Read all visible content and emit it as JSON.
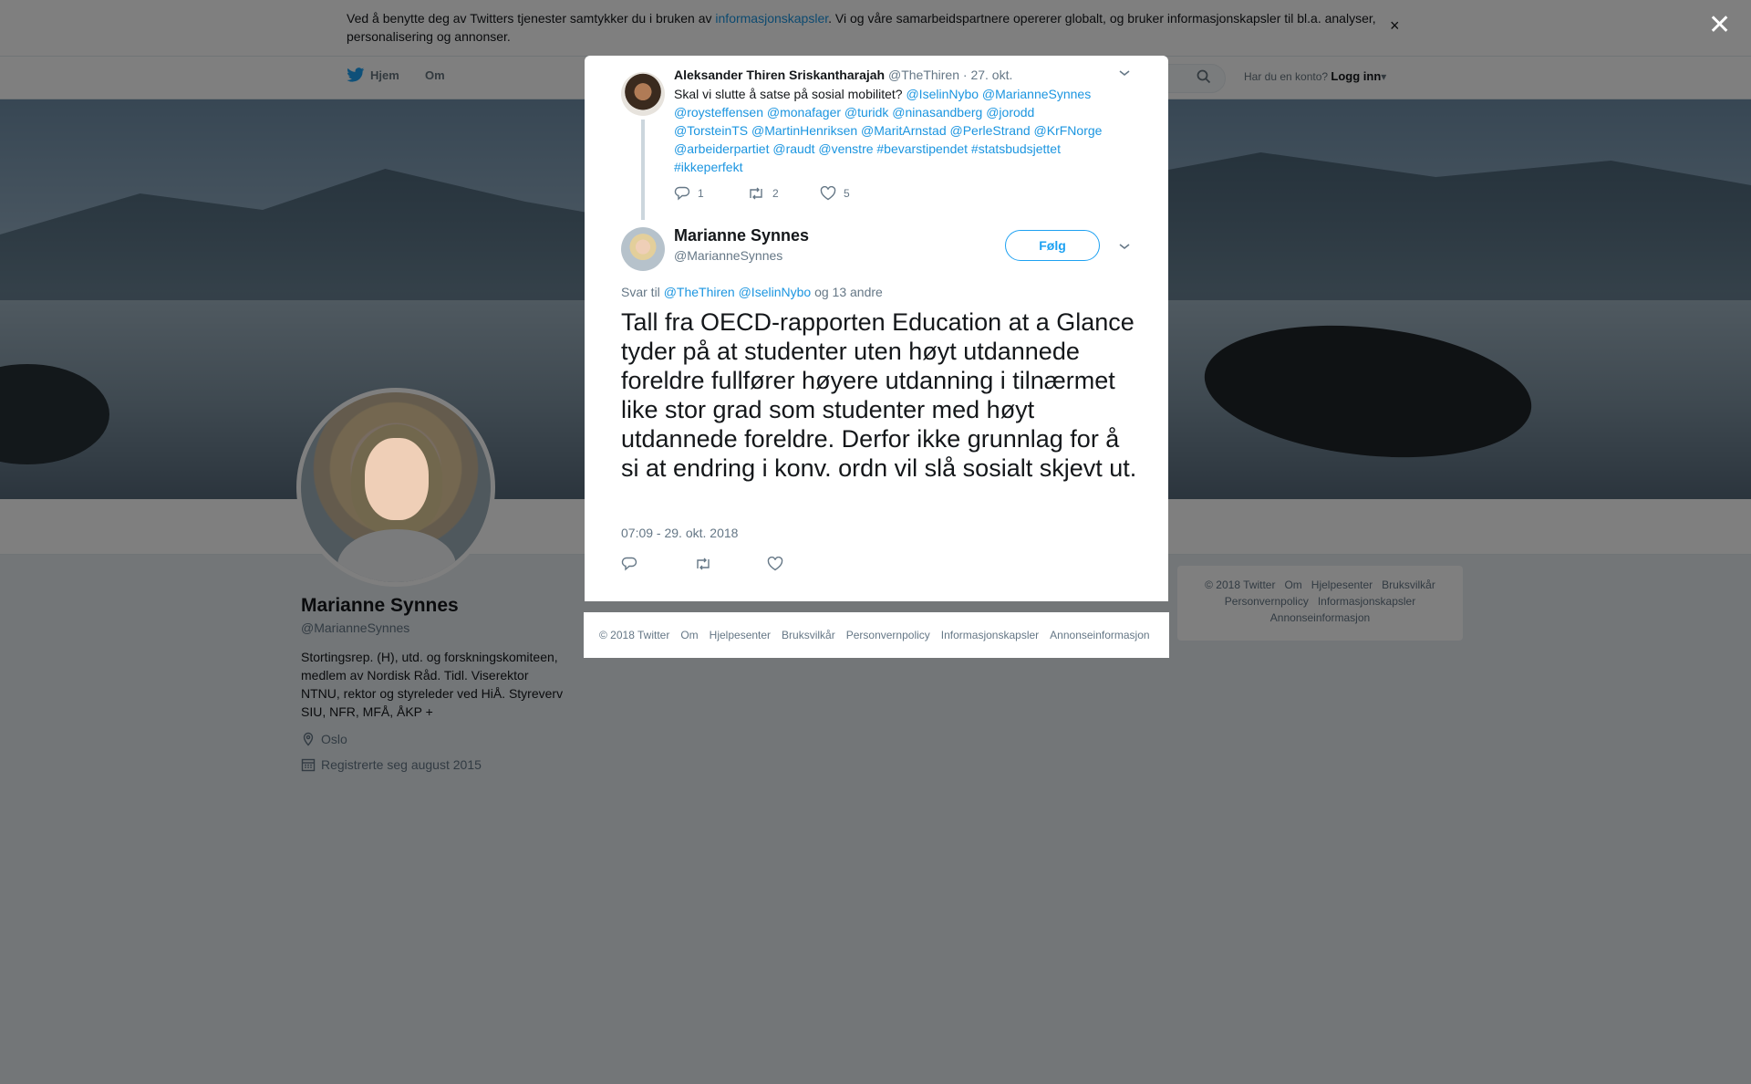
{
  "cookie": {
    "text_before": "Ved å benytte deg av Twitters tjenester samtykker du i bruken av ",
    "link": "informasjonskapsler",
    "text_after": ". Vi og våre samarbeidspartnere opererer globalt, og bruker informasjonskapsler til bl.a. analyser, personalisering og annonser.",
    "close": "×"
  },
  "nav": {
    "home": "Hjem",
    "about": "Om",
    "account_prompt": "Har du en konto?",
    "login": "Logg inn",
    "login_caret": "▾"
  },
  "profile": {
    "name": "Marianne Synnes",
    "handle": "@MarianneSynnes",
    "bio": "Stortingsrep. (H), utd. og forskningskomiteen, medlem av Nordisk Råd. Tidl. Viserektor NTNU, rektor og styreleder ved HiÅ. Styreverv SIU, NFR, MFÅ, ÅKP +",
    "location": "Oslo",
    "joined": "Registrerte seg august 2015"
  },
  "side_footer": {
    "line1": [
      "© 2018 Twitter",
      "Om",
      "Hjelpesenter",
      "Bruksvilkår"
    ],
    "line2": [
      "Personvernpolicy",
      "Informasjonskapsler"
    ],
    "line3": [
      "Annonseinformasjon"
    ]
  },
  "modal": {
    "close": "✕",
    "parent": {
      "name": "Aleksander Thiren Sriskantharajah",
      "handle": "@TheThiren",
      "date": "· 27. okt.",
      "text_plain": "Skal vi slutte å satse på sosial mobilitet? ",
      "text_links": "@IselinNybo @MarianneSynnes @roysteffensen  @monafager @turidk @ninasandberg @jorodd @TorsteinTS @MartinHenriksen @MaritArnstad @PerleStrand @KrFNorge @arbeiderpartiet @raudt @venstre #bevarstipendet #statsbudsjettet #ikkeperfekt",
      "replies": "1",
      "retweets": "2",
      "likes": "5"
    },
    "main": {
      "name": "Marianne Synnes",
      "handle": "@MarianneSynnes",
      "follow": "Følg",
      "reply_prefix": "Svar til ",
      "reply_links": "@TheThiren @IselinNybo",
      "reply_suffix": " og 13 andre",
      "text": "Tall fra OECD-rapporten Education at a Glance tyder på at studenter uten høyt utdannede foreldre fullfører høyere utdanning i tilnærmet like stor grad som studenter med høyt utdannede foreldre. Derfor ikke grunnlag for å si at endring i konv. ordn vil slå sosialt skjevt ut.",
      "timestamp": "07:09 - 29. okt. 2018"
    },
    "footer": [
      "© 2018 Twitter",
      "Om",
      "Hjelpesenter",
      "Bruksvilkår",
      "Personvernpolicy",
      "Informasjonskapsler",
      "Annonseinformasjon"
    ]
  }
}
